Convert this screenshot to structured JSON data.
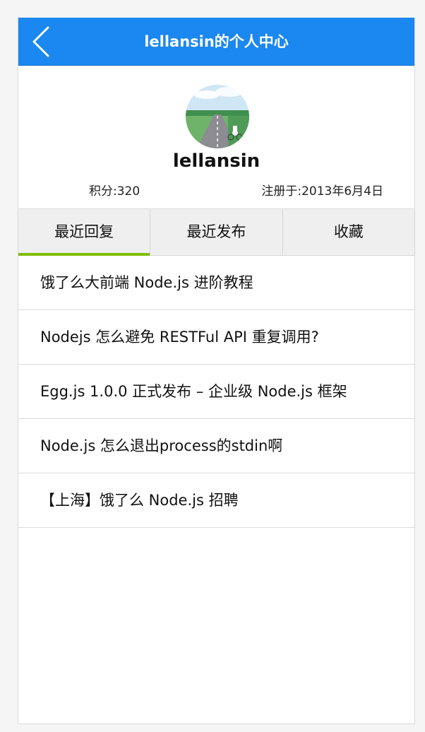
{
  "header": {
    "title": "lellansin的个人中心",
    "back_icon": "chevron-left-icon",
    "bar_color": "#1b87f0"
  },
  "profile": {
    "avatar": "avatar-image",
    "username": "lellansin",
    "score": "积分:320",
    "registered": "注册于:2013年6月4日"
  },
  "tabs": [
    {
      "label": "最近回复",
      "active": true
    },
    {
      "label": "最近发布",
      "active": false
    },
    {
      "label": "收藏",
      "active": false
    }
  ],
  "active_tab_color": "#80bd01",
  "topics": [
    {
      "title": "饿了么大前端 Node.js 进阶教程"
    },
    {
      "title": "Nodejs 怎么避免 RESTFul API 重复调用?"
    },
    {
      "title": "Egg.js 1.0.0 正式发布 – 企业级 Node.js 框架"
    },
    {
      "title": "Node.js 怎么退出process的stdin啊"
    },
    {
      "title": "【上海】饿了么 Node.js 招聘"
    }
  ]
}
